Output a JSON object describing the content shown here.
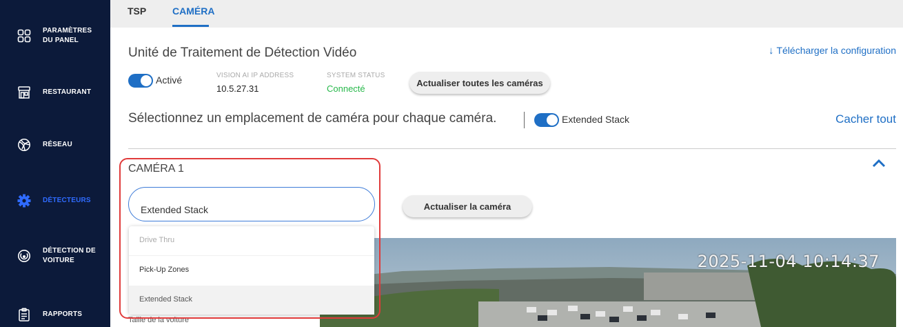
{
  "sidebar": {
    "items": [
      {
        "label": "PARAMÈTRES\nDU PANEL",
        "icon": "grid-icon"
      },
      {
        "label": "RESTAURANT",
        "icon": "store-icon"
      },
      {
        "label": "RÉSEAU",
        "icon": "globe-icon"
      },
      {
        "label": "DÉTECTEURS",
        "icon": "gear-icon",
        "active": true
      },
      {
        "label": "DÉTECTION DE\nVOITURE",
        "icon": "target-icon"
      },
      {
        "label": "RAPPORTS",
        "icon": "clipboard-icon"
      }
    ]
  },
  "tabs": [
    {
      "label": "TSP"
    },
    {
      "label": "CAMÉRA",
      "active": true
    }
  ],
  "unit": {
    "title": "Unité de Traitement de Détection Vidéo",
    "download_label": "Télécharger la configuration",
    "enabled_label": "Activé",
    "ip_label": "VISION AI IP ADDRESS",
    "ip_value": "10.5.27.31",
    "status_label": "SYSTEM STATUS",
    "status_value": "Connecté",
    "refresh_all_label": "Actualiser toutes les caméras"
  },
  "selection": {
    "prompt": "Sélectionnez un emplacement de caméra pour chaque caméra.",
    "toggle_label": "Extended Stack",
    "hide_all_label": "Cacher tout"
  },
  "camera": {
    "title": "CAMÉRA 1",
    "selected_location": "Extended Stack",
    "refresh_label": "Actualiser la caméra",
    "options": [
      {
        "label": "Drive Thru"
      },
      {
        "label": "Pick-Up Zones"
      },
      {
        "label": "Extended Stack"
      }
    ],
    "timestamp": "2025-11-04 10:14:37",
    "car_size_label": "Taille de la voiture"
  },
  "colors": {
    "sidebar_bg": "#0c1a3a",
    "accent": "#1f6fc5",
    "status_green": "#27b84a",
    "highlight": "#e03a3a"
  }
}
